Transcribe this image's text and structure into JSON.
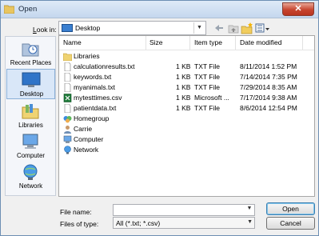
{
  "window": {
    "title": "Open"
  },
  "toolbar": {
    "look_in_label_u": "L",
    "look_in_label_rest": "ook in:",
    "look_in_value": "Desktop"
  },
  "places": [
    {
      "label": "Recent Places",
      "icon": "recent-places-icon"
    },
    {
      "label": "Desktop",
      "icon": "desktop-icon",
      "selected": true
    },
    {
      "label": "Libraries",
      "icon": "libraries-icon"
    },
    {
      "label": "Computer",
      "icon": "computer-icon"
    },
    {
      "label": "Network",
      "icon": "network-icon"
    }
  ],
  "columns": {
    "name": "Name",
    "size": "Size",
    "type": "Item type",
    "date": "Date modified"
  },
  "files": [
    {
      "name": "Libraries",
      "size": "",
      "type": "",
      "date": "",
      "icon": "libraries-folder-icon"
    },
    {
      "name": "calculationresults.txt",
      "size": "1 KB",
      "type": "TXT File",
      "date": "8/11/2014 1:52 PM",
      "icon": "text-file-icon"
    },
    {
      "name": "keywords.txt",
      "size": "1 KB",
      "type": "TXT File",
      "date": "7/14/2014 7:35 PM",
      "icon": "text-file-icon"
    },
    {
      "name": "myanimals.txt",
      "size": "1 KB",
      "type": "TXT File",
      "date": "7/29/2014 8:35 AM",
      "icon": "text-file-icon"
    },
    {
      "name": "mytesttimes.csv",
      "size": "1 KB",
      "type": "Microsoft ...",
      "date": "7/17/2014 9:38 AM",
      "icon": "excel-file-icon"
    },
    {
      "name": "patientdata.txt",
      "size": "1 KB",
      "type": "TXT File",
      "date": "8/6/2014 12:54 PM",
      "icon": "text-file-icon"
    },
    {
      "name": "Homegroup",
      "size": "",
      "type": "",
      "date": "",
      "icon": "homegroup-icon"
    },
    {
      "name": "Carrie",
      "size": "",
      "type": "",
      "date": "",
      "icon": "user-folder-icon"
    },
    {
      "name": "Computer",
      "size": "",
      "type": "",
      "date": "",
      "icon": "computer-icon"
    },
    {
      "name": "Network",
      "size": "",
      "type": "",
      "date": "",
      "icon": "network-icon"
    }
  ],
  "footer": {
    "file_name_label": "File name:",
    "file_name_value": "",
    "file_type_label": "Files of type:",
    "file_type_value": "All (*.txt; *.csv)",
    "open_label": "Open",
    "cancel_label": "Cancel"
  }
}
